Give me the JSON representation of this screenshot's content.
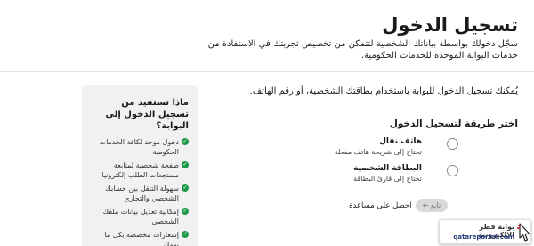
{
  "header": {
    "title": "تسجيل الدخول",
    "subtitle": "سجّل دخولك بواسطة بياناتك الشخصية لتتمكن من تخصيص تجربتك في الاستفادة من خدمات البوابة الموحدة للخدمات الحكومية."
  },
  "intro": "يُمكنك تسجيل الدخول للبوابة باستخدام بطاقتك الشخصية، أو رقم الهاتف.",
  "login_methods": {
    "heading": "اختر طريقة لتسجيل الدخول",
    "options": [
      {
        "title": "هاتف نقال",
        "desc": "تحتاج إلى شريحة هاتف مفعلة"
      },
      {
        "title": "البطاقة الشخصية",
        "desc": "تحتاج إلى قارئ البطاقة"
      }
    ]
  },
  "actions": {
    "next_label": "تابع ←",
    "help_label": "احصل على مساعدة"
  },
  "benefits": {
    "title": "ماذا تستفيد من تسجيل الدخول إلى البوابة؟",
    "items": [
      "دخول موحد لكافة الخدمات الحكومية",
      "صفحة شخصية لمتابعة مستجدات الطلب إلكترونيا",
      "سهولة التنقل بين حسابك الشخصي والتجاري",
      "إمكانية تعديل بيانات ملفك الشخصي",
      "إشعارات مخصصة بكل ما يهمك"
    ]
  },
  "watermark": {
    "name_ar": "بوابة قطر الإلكترونية",
    "domain": "qatareportal.com"
  },
  "colors": {
    "check": "#1f9a4a",
    "panel": "#f1f1f3",
    "button_disabled": "#d9d9d9"
  }
}
